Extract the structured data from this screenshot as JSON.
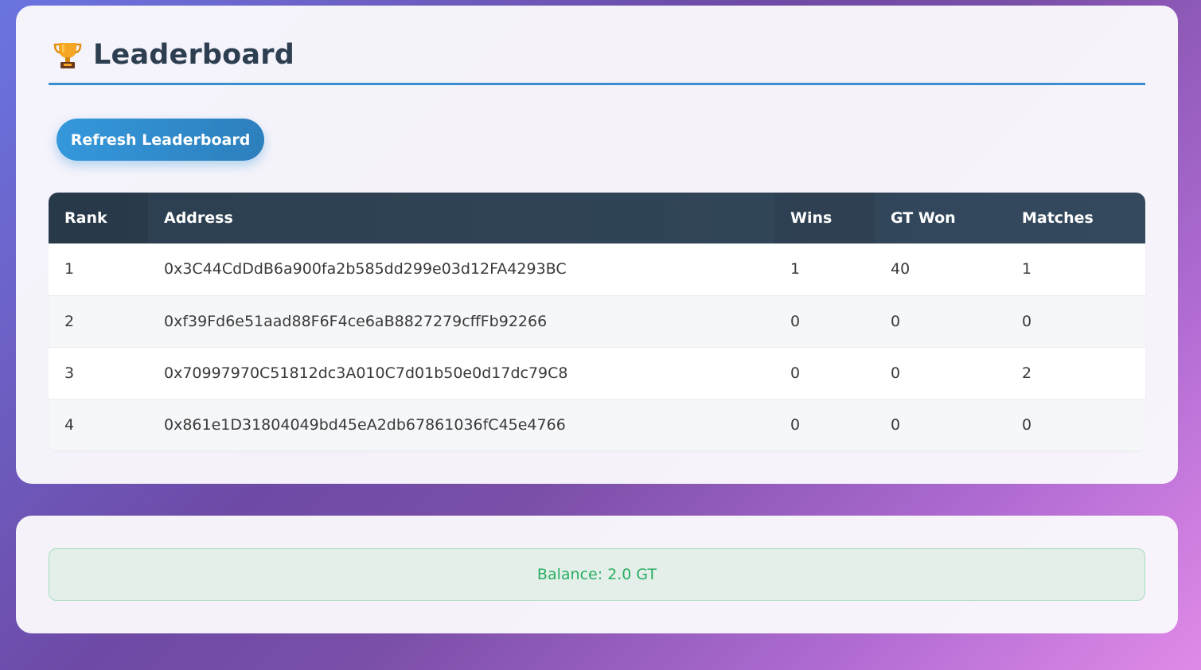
{
  "leaderboard": {
    "icon": "trophy-icon",
    "title": "Leaderboard",
    "refresh_label": "Refresh Leaderboard",
    "columns": [
      "Rank",
      "Address",
      "Wins",
      "GT Won",
      "Matches"
    ],
    "rows": [
      {
        "rank": "1",
        "address": "0x3C44CdDdB6a900fa2b585dd299e03d12FA4293BC",
        "wins": "1",
        "gt_won": "40",
        "matches": "1"
      },
      {
        "rank": "2",
        "address": "0xf39Fd6e51aad88F6F4ce6aB8827279cffFb92266",
        "wins": "0",
        "gt_won": "0",
        "matches": "0"
      },
      {
        "rank": "3",
        "address": "0x70997970C51812dc3A010C7d01b50e0d17dc79C8",
        "wins": "0",
        "gt_won": "0",
        "matches": "2"
      },
      {
        "rank": "4",
        "address": "0x861e1D31804049bd45eA2db67861036fC45e4766",
        "wins": "0",
        "gt_won": "0",
        "matches": "0"
      }
    ]
  },
  "balance": {
    "text": "Balance: 2.0 GT"
  },
  "colors": {
    "accent": "#3498db",
    "header_bg": "#2c3e50",
    "title": "#2c3e50",
    "balance_text": "#27ae60"
  }
}
